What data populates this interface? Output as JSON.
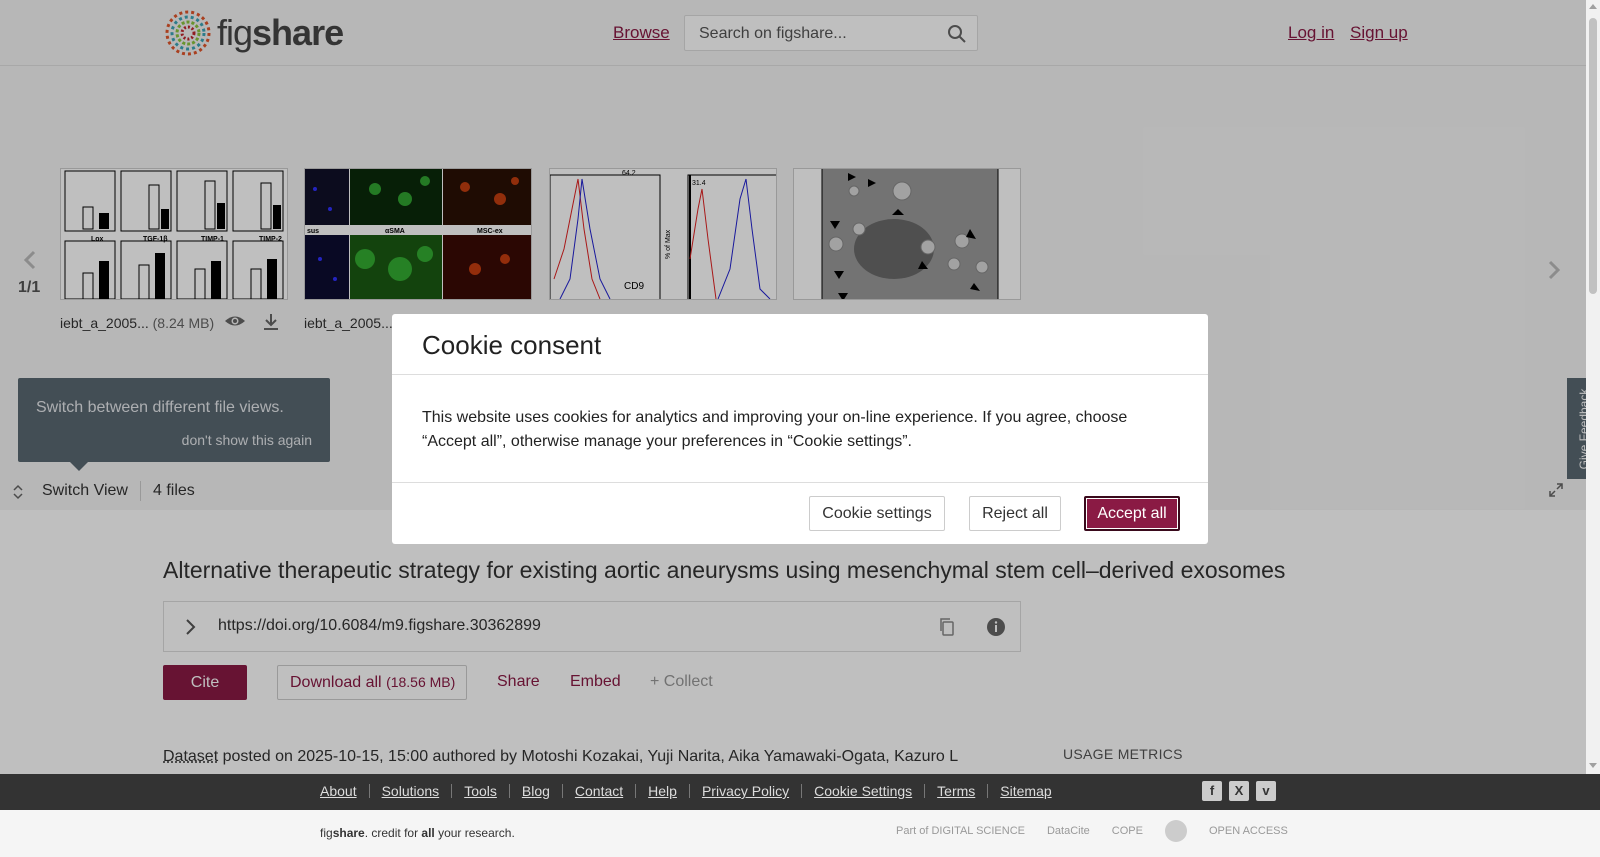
{
  "header": {
    "logo_text_light": "fig",
    "logo_text_bold": "share",
    "browse": "Browse",
    "search_placeholder": "Search on figshare...",
    "login": "Log in",
    "signup": "Sign up"
  },
  "viewer": {
    "page_indicator": "1/1",
    "files": [
      {
        "name": "iebt_a_2005...",
        "size": "(8.24 MB)"
      },
      {
        "name": "iebt_a_2005..."
      }
    ],
    "thumb2_labels": [
      "sus",
      "αSMA",
      "MSC-ex"
    ],
    "thumb3_labels": [
      "64.2",
      "CD9",
      "31.4",
      "% of Max"
    ],
    "thumb1_labels": [
      "Lox",
      "TGF-1β",
      "TIMP-1",
      "TIMP-2"
    ],
    "tooltip_text": "Switch between different file views.",
    "tooltip_dismiss": "don't show this again",
    "switch_view": "Switch View",
    "files_count": "4 files"
  },
  "feedback": "Give Feedback",
  "article": {
    "title": "Alternative therapeutic strategy for existing aortic aneurysms using mesenchymal stem cell–derived exosomes",
    "doi": "https://doi.org/10.6084/m9.figshare.30362899",
    "cite": "Cite",
    "download_all": "Download all",
    "download_size": "(18.56 MB)",
    "share": "Share",
    "embed": "Embed",
    "collect": "+ Collect",
    "dataset_type": "Dataset",
    "posted_text": " posted on 2025-10-15, 15:00 authored by Motoshi Kozakai, Yuji Narita, Aika Yamawaki-Ogata, Kazuro L",
    "usage_metrics": "USAGE METRICS"
  },
  "cookie": {
    "title": "Cookie consent",
    "body": "This website uses cookies for analytics and improving your on-line experience. If you agree, choose “Accept all”, otherwise manage your preferences in “Cookie settings”.",
    "settings": "Cookie settings",
    "reject": "Reject all",
    "accept": "Accept all"
  },
  "footer": {
    "links": [
      "About",
      "Solutions",
      "Tools",
      "Blog",
      "Contact",
      "Help",
      "Privacy Policy",
      "Cookie Settings",
      "Terms",
      "Sitemap"
    ],
    "credit_fig": "fig",
    "credit_share": "share",
    "credit_mid": ". credit for ",
    "credit_all": "all",
    "credit_end": " your research.",
    "partners": [
      "Part of DIGITAL SCIENCE",
      "DataCite",
      "COPE",
      "",
      "OPEN ACCESS"
    ]
  },
  "colors": {
    "brand": "#8a1a44",
    "tooltip_bg": "#5a6872",
    "footer_dark": "#333333"
  }
}
